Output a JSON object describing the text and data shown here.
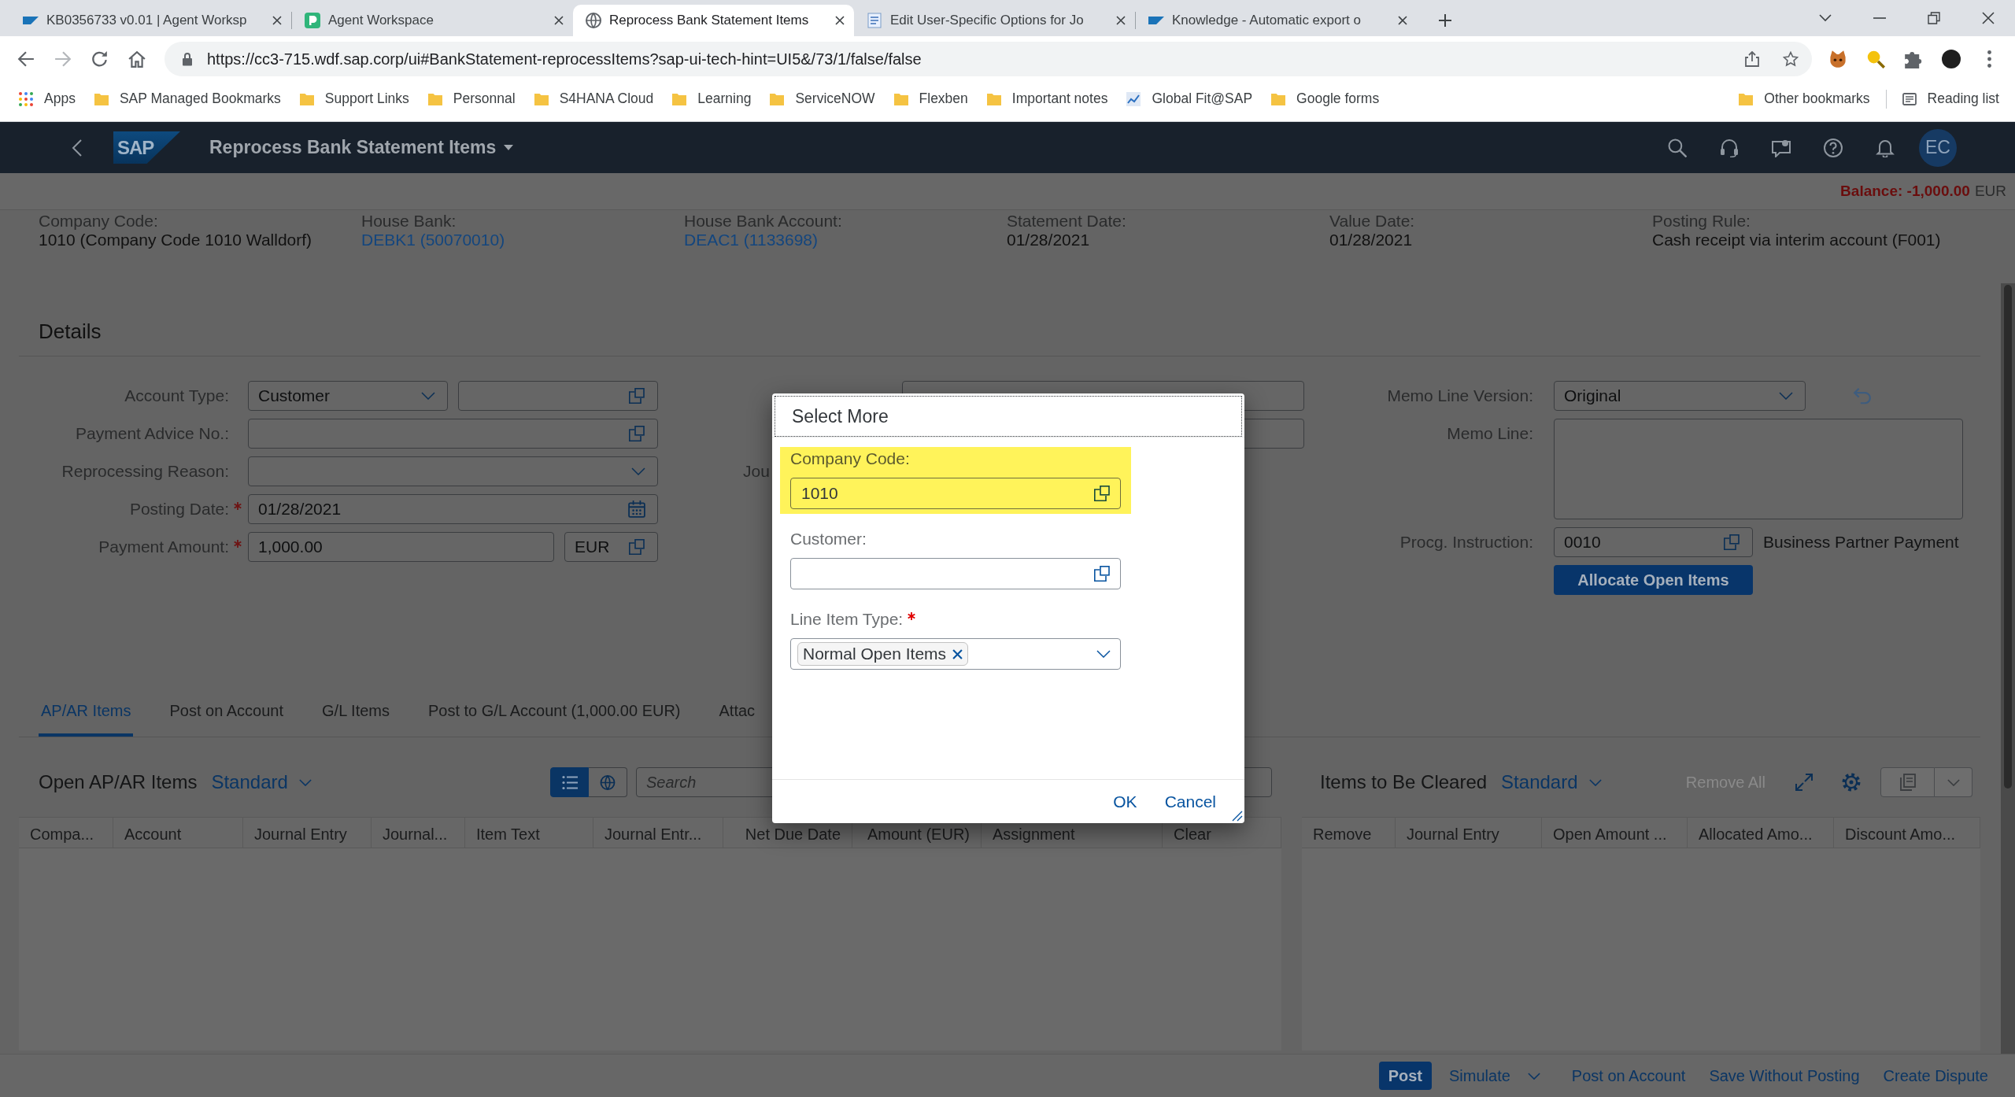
{
  "browser": {
    "tabs": [
      {
        "kind": "sap",
        "title": "KB0356733 v0.01 | Agent Worksp",
        "selected": false
      },
      {
        "kind": "workspace",
        "title": "Agent Workspace",
        "selected": false
      },
      {
        "kind": "globe",
        "title": "Reprocess Bank Statement Items",
        "selected": true
      },
      {
        "kind": "document",
        "title": "Edit User-Specific Options for Jo",
        "selected": false
      },
      {
        "kind": "sap",
        "title": "Knowledge - Automatic export o",
        "selected": false
      }
    ],
    "url": "https://cc3-715.wdf.sap.corp/ui#BankStatement-reprocessItems?sap-ui-tech-hint=UI5&/73/1/false/false",
    "bookmarks": [
      {
        "kind": "apps",
        "label": "Apps"
      },
      {
        "kind": "folder",
        "label": "SAP Managed Bookmarks"
      },
      {
        "kind": "folder",
        "label": "Support Links"
      },
      {
        "kind": "folder",
        "label": "Personnal"
      },
      {
        "kind": "folder",
        "label": "S4HANA Cloud"
      },
      {
        "kind": "folder",
        "label": "Learning"
      },
      {
        "kind": "folder",
        "label": "ServiceNOW"
      },
      {
        "kind": "folder",
        "label": "Flexben"
      },
      {
        "kind": "folder",
        "label": "Important notes"
      },
      {
        "kind": "page",
        "label": "Global Fit@SAP"
      },
      {
        "kind": "folder",
        "label": "Google forms"
      }
    ],
    "bookmarks_right": [
      {
        "kind": "folder",
        "label": "Other bookmarks"
      },
      {
        "kind": "reading",
        "label": "Reading list"
      }
    ]
  },
  "shell": {
    "logo": "SAP",
    "title": "Reprocess Bank Statement Items",
    "avatar": "EC"
  },
  "header": {
    "balance": "Balance: -1,000.00",
    "currency": "EUR",
    "attributes": [
      {
        "label": "Company Code:",
        "value": "1010 (Company Code 1010 Walldorf)",
        "link": false
      },
      {
        "label": "House Bank:",
        "value": "DEBK1 (50070010)",
        "link": true
      },
      {
        "label": "House Bank Account:",
        "value": "DEAC1 (1133698)",
        "link": true
      },
      {
        "label": "Statement Date:",
        "value": "01/28/2021",
        "link": false
      },
      {
        "label": "Value Date:",
        "value": "01/28/2021",
        "link": false
      },
      {
        "label": "Posting Rule:",
        "value": "Cash receipt via interim account (F001)",
        "link": false
      }
    ]
  },
  "details": {
    "title": "Details",
    "left": [
      {
        "label": "Account Type:",
        "required": false,
        "controls": [
          {
            "kind": "select",
            "value": "Customer"
          },
          {
            "kind": "valuehelp"
          }
        ]
      },
      {
        "label": "Payment Advice No.:",
        "required": false,
        "controls": [
          {
            "kind": "valuehelp"
          }
        ]
      },
      {
        "label": "Reprocessing Reason:",
        "required": false,
        "controls": [
          {
            "kind": "select"
          }
        ]
      },
      {
        "label": "Posting Date:",
        "required": true,
        "controls": [
          {
            "kind": "date",
            "value": "01/28/2021"
          }
        ]
      },
      {
        "label": "Payment Amount:",
        "required": true,
        "controls": [
          {
            "kind": "input",
            "value": "1,000.00"
          },
          {
            "kind": "currency",
            "value": "EUR"
          }
        ]
      }
    ],
    "middle": [
      {
        "controls": [
          {
            "kind": "input"
          }
        ]
      },
      {
        "controls": [
          {
            "kind": "input"
          }
        ]
      },
      {
        "label": "Jou"
      }
    ],
    "memo_version": {
      "label": "Memo Line Version:",
      "value": "Original"
    },
    "memo_line": {
      "label": "Memo Line:"
    },
    "instruction": {
      "label": "Procg. Instruction:",
      "value": "0010",
      "description": "Business Partner Payment"
    },
    "allocate_button": "Allocate Open Items"
  },
  "tabs": [
    {
      "label": "AP/AR Items",
      "selected": true
    },
    {
      "label": "Post on Account",
      "selected": false
    },
    {
      "label": "G/L Items",
      "selected": false
    },
    {
      "label": "Post to G/L Account (1,000.00 EUR)",
      "selected": false
    },
    {
      "label": "Attac",
      "selected": false
    }
  ],
  "open_items": {
    "title": "Open AP/AR Items",
    "variant": "Standard",
    "view_modes": [
      {
        "kind": "list",
        "selected": true
      },
      {
        "kind": "map",
        "selected": false
      }
    ],
    "search": {
      "placeholder": "Search"
    },
    "columns": [
      "Compa...",
      "Account",
      "Journal Entry",
      "Journal...",
      "Item Text",
      "Journal Entr...",
      "Net Due Date",
      "Amount (EUR)",
      "Assignment",
      "Clear"
    ]
  },
  "cleared_items": {
    "title": "Items to Be Cleared",
    "variant": "Standard",
    "remove_all": {
      "label": "Remove All",
      "disabled": true
    },
    "columns": [
      "Remove",
      "Journal Entry",
      "Open Amount ...",
      "Allocated Amo...",
      "Discount Amo..."
    ]
  },
  "footer": {
    "actions": [
      {
        "kind": "emphasized",
        "label": "Post"
      },
      {
        "kind": "menu",
        "label": "Simulate"
      },
      {
        "kind": "plain",
        "label": "Post on Account"
      },
      {
        "kind": "plain",
        "label": "Save Without Posting"
      },
      {
        "kind": "plain",
        "label": "Create Dispute"
      }
    ]
  },
  "dialog": {
    "title": "Select More",
    "fields": [
      {
        "label": "Company Code:",
        "required": false,
        "highlighted": true,
        "kind": "valuehelp",
        "value": "1010"
      },
      {
        "label": "Customer:",
        "required": false,
        "highlighted": false,
        "kind": "valuehelp"
      },
      {
        "label": "Line Item Type:",
        "required": true,
        "highlighted": false,
        "kind": "multicombo",
        "tokens": [
          "Normal Open Items"
        ]
      }
    ],
    "buttons": [
      "OK",
      "Cancel"
    ]
  }
}
